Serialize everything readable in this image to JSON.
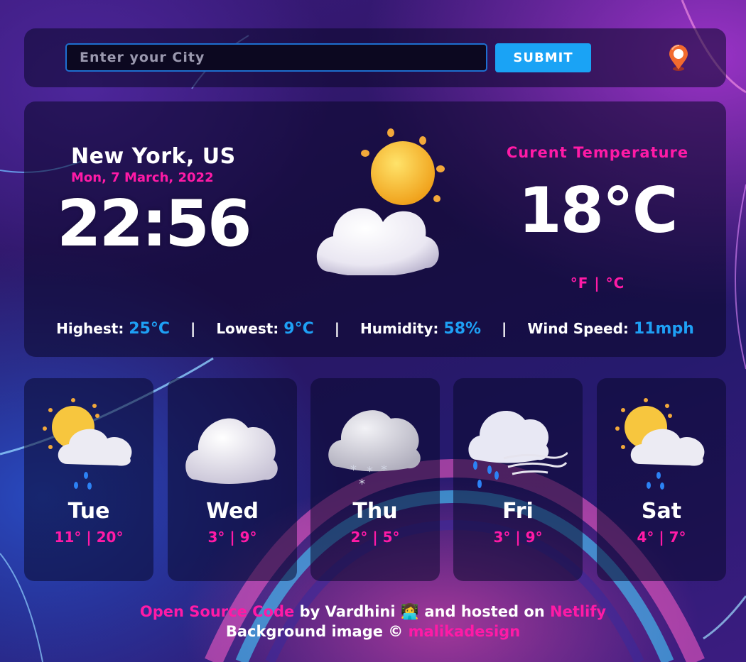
{
  "search": {
    "placeholder": "Enter your City",
    "value": "",
    "submit_label": "SUBMIT"
  },
  "current": {
    "city": "New York, US",
    "date": "Mon, 7 March, 2022",
    "time": "22:56",
    "temp_label": "Curent Temperature",
    "temperature": "18°C",
    "unit_f": "°F",
    "unit_sep": "|",
    "unit_c": "°C",
    "icon": "partly-cloudy-icon"
  },
  "stats": {
    "highest_label": "Highest:",
    "highest_value": "25°C",
    "lowest_label": "Lowest:",
    "lowest_value": "9°C",
    "humidity_label": "Humidity:",
    "humidity_value": "58%",
    "wind_label": "Wind Speed:",
    "wind_value": "11mph",
    "separator": "|"
  },
  "forecast": [
    {
      "day": "Tue",
      "temps": "11° | 20°",
      "icon": "sun-cloud-rain-icon"
    },
    {
      "day": "Wed",
      "temps": "3° | 9°",
      "icon": "cloud-icon"
    },
    {
      "day": "Thu",
      "temps": "2° | 5°",
      "icon": "cloud-snow-icon"
    },
    {
      "day": "Fri",
      "temps": "3° | 9°",
      "icon": "cloud-wind-rain-icon"
    },
    {
      "day": "Sat",
      "temps": "4° | 7°",
      "icon": "sun-cloud-rain-icon"
    }
  ],
  "footer": {
    "source_link": "Open Source Code",
    "by_text": " by Vardhini ",
    "emoji": "👩‍💻",
    "hosted_text": " and hosted on ",
    "host_link": "Netlify",
    "bg_text": "Background image © ",
    "bg_link": "malikadesign"
  },
  "colors": {
    "accent_pink": "#ff1aa6",
    "accent_blue": "#1ea0f5",
    "button_blue": "#1aa3f5"
  }
}
